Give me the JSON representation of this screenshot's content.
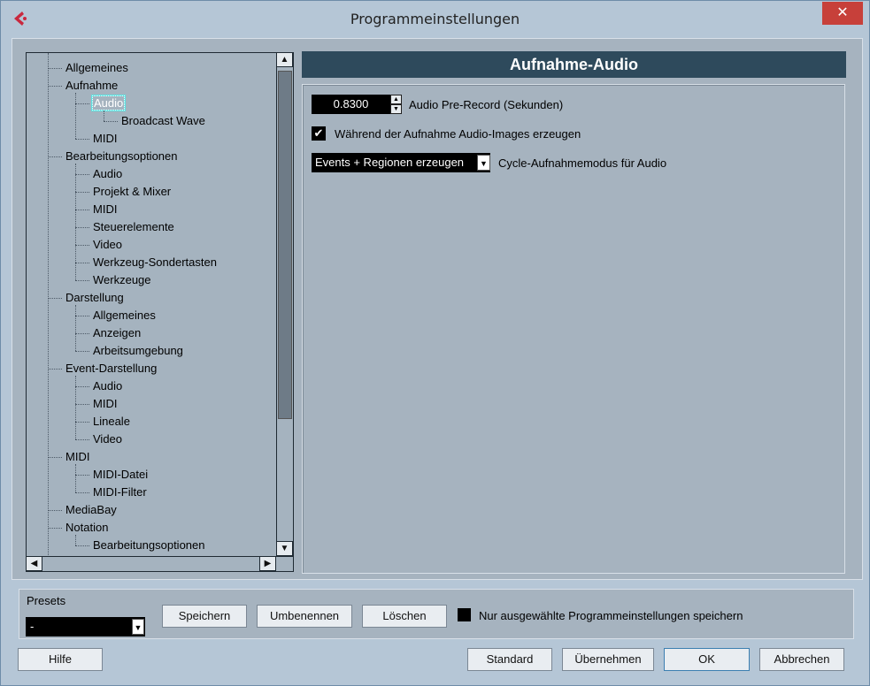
{
  "window": {
    "title": "Programmeinstellungen",
    "close_glyph": "✕"
  },
  "tree": {
    "items": [
      {
        "label": "Allgemeines",
        "level": 0
      },
      {
        "label": "Aufnahme",
        "level": 0
      },
      {
        "label": "Audio",
        "level": 1,
        "selected": true
      },
      {
        "label": "Broadcast Wave",
        "level": 2
      },
      {
        "label": "MIDI",
        "level": 1
      },
      {
        "label": "Bearbeitungsoptionen",
        "level": 0
      },
      {
        "label": "Audio",
        "level": 1
      },
      {
        "label": "Projekt & Mixer",
        "level": 1
      },
      {
        "label": "MIDI",
        "level": 1
      },
      {
        "label": "Steuerelemente",
        "level": 1
      },
      {
        "label": "Video",
        "level": 1
      },
      {
        "label": "Werkzeug-Sondertasten",
        "level": 1
      },
      {
        "label": "Werkzeuge",
        "level": 1
      },
      {
        "label": "Darstellung",
        "level": 0
      },
      {
        "label": "Allgemeines",
        "level": 1
      },
      {
        "label": "Anzeigen",
        "level": 1
      },
      {
        "label": "Arbeitsumgebung",
        "level": 1
      },
      {
        "label": "Event-Darstellung",
        "level": 0
      },
      {
        "label": "Audio",
        "level": 1
      },
      {
        "label": "MIDI",
        "level": 1
      },
      {
        "label": "Lineale",
        "level": 1
      },
      {
        "label": "Video",
        "level": 1
      },
      {
        "label": "MIDI",
        "level": 0
      },
      {
        "label": "MIDI-Datei",
        "level": 1
      },
      {
        "label": "MIDI-Filter",
        "level": 1
      },
      {
        "label": "MediaBay",
        "level": 0
      },
      {
        "label": "Notation",
        "level": 0
      },
      {
        "label": "Bearbeitungsoptionen",
        "level": 1
      }
    ]
  },
  "section": {
    "title": "Aufnahme-Audio",
    "pre_record": {
      "value": "0.8300",
      "label": "Audio Pre-Record (Sekunden)"
    },
    "audio_images": {
      "checked": true,
      "label": "Während der Aufnahme Audio-Images erzeugen"
    },
    "cycle_mode": {
      "value": "Events + Regionen erzeugen",
      "label": "Cycle-Aufnahmemodus für Audio"
    }
  },
  "presets": {
    "label": "Presets",
    "selected": "-",
    "save_label": "Speichern",
    "rename_label": "Umbenennen",
    "delete_label": "Löschen",
    "only_selected": {
      "checked": false,
      "label": "Nur ausgewählte Programmeinstellungen speichern"
    }
  },
  "footer": {
    "help_label": "Hilfe",
    "standard_label": "Standard",
    "apply_label": "Übernehmen",
    "ok_label": "OK",
    "cancel_label": "Abbrechen"
  },
  "colors": {
    "header_bg": "#2e4a5c",
    "panel_bg": "#a6b3bf",
    "close_bg": "#c7403a"
  }
}
